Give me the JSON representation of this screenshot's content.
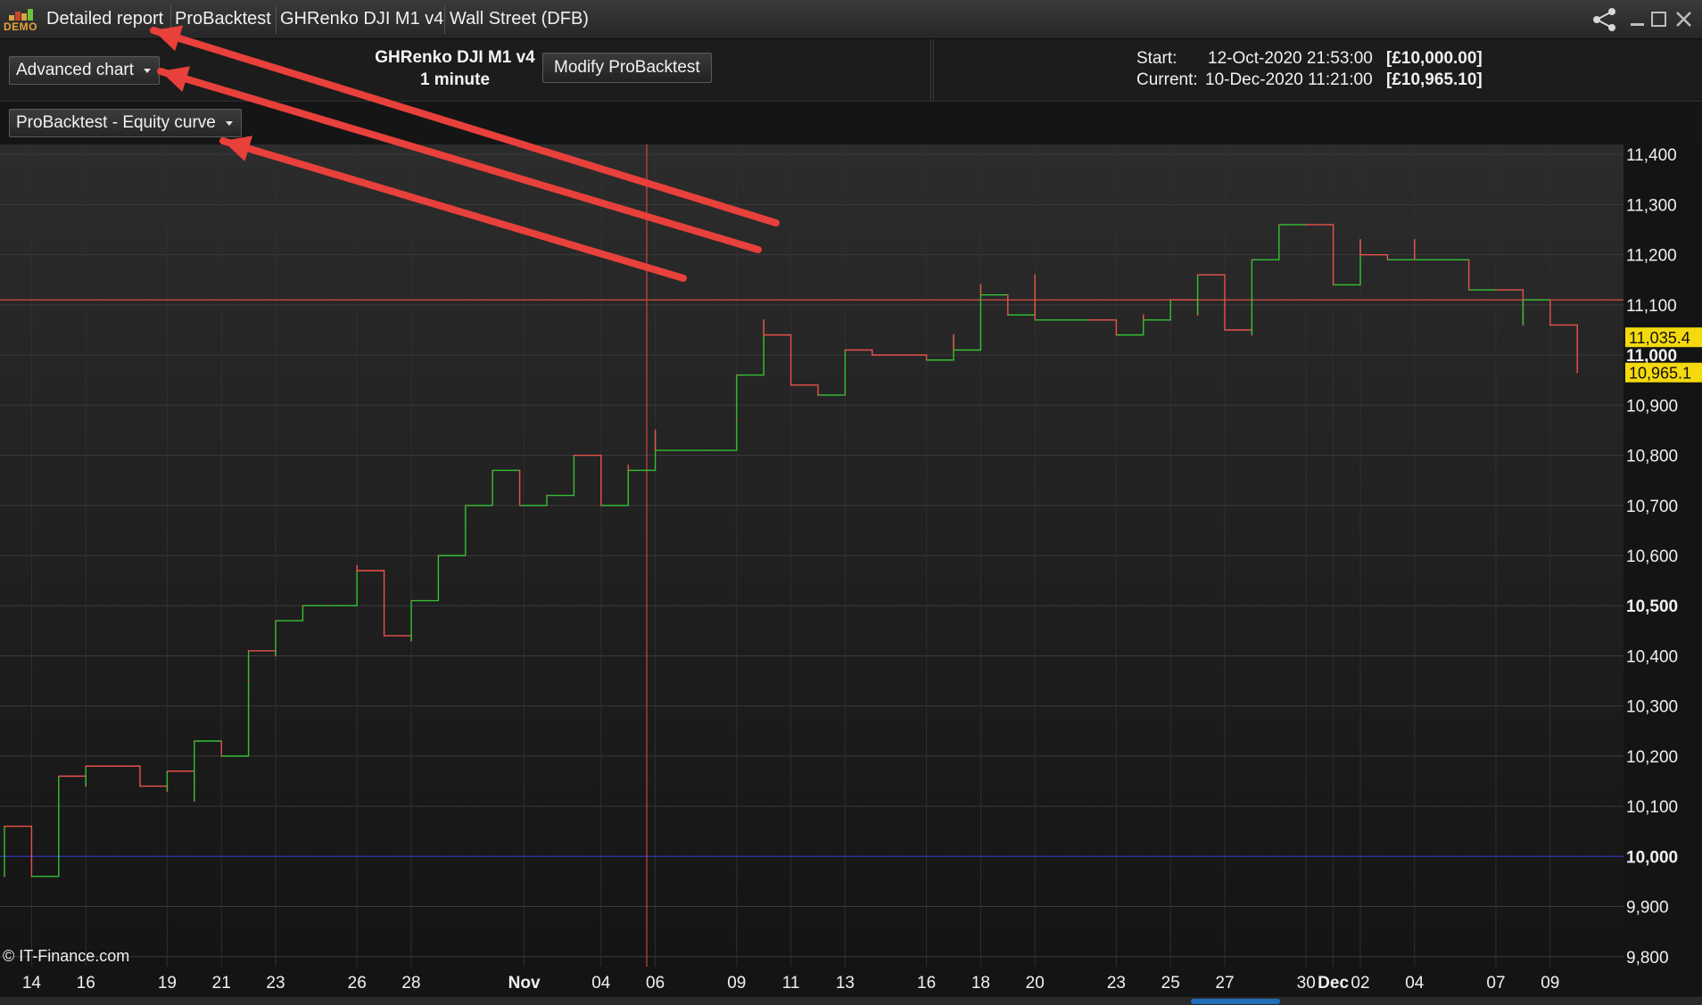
{
  "titlebar": {
    "logo_text": "DEMO",
    "tabs": [
      "Detailed report",
      "ProBacktest",
      "GHRenko DJI M1 v4",
      "Wall Street (DFB)"
    ],
    "icons": [
      "share-icon",
      "minimize-icon",
      "maximize-icon",
      "close-icon"
    ]
  },
  "header": {
    "chart_menu": "Advanced chart",
    "system_name": "GHRenko DJI M1 v4",
    "timeframe": "1 minute",
    "modify_button": "Modify ProBacktest",
    "start_label": "Start:",
    "start_date": "12-Oct-2020 21:53:00",
    "start_value": "[£10,000.00]",
    "current_label": "Current:",
    "current_date": "10-Dec-2020 11:21:00",
    "current_value": "[£10,965.10]"
  },
  "indicator_menu": "ProBacktest - Equity curve",
  "copyright": "© IT-Finance.com",
  "colors": {
    "up": "#33c233",
    "down": "#e8524a",
    "arrow": "#e8403a",
    "hline_red": "#c8473f",
    "hline_blue": "#2b33a8",
    "price_tag": "#f4d90e"
  },
  "chart_data": {
    "type": "line",
    "title": "ProBacktest - Equity curve",
    "ylim": [
      9780,
      11420
    ],
    "y_ticks": [
      9800,
      9900,
      10000,
      10100,
      10200,
      10300,
      10400,
      10500,
      10600,
      10700,
      10800,
      10900,
      11000,
      11100,
      11200,
      11300,
      11400
    ],
    "y_tick_labels": [
      "9,800",
      "9,900",
      "10,000",
      "10,100",
      "10,200",
      "10,300",
      "10,400",
      "10,500",
      "10,600",
      "10,700",
      "10,800",
      "10,900",
      "11,000",
      "11,100",
      "11,200",
      "11,300",
      "11,400"
    ],
    "bold_ticks": [
      "10,000",
      "10,500",
      "11,000"
    ],
    "x_tick_labels": [
      "14",
      "16",
      "19",
      "21",
      "23",
      "26",
      "28",
      "Nov",
      "04",
      "06",
      "09",
      "11",
      "13",
      "16",
      "18",
      "20",
      "23",
      "25",
      "27",
      "30",
      "Dec",
      "02",
      "04",
      "07",
      "09"
    ],
    "bold_x_ticks": [
      "Nov",
      "Dec"
    ],
    "reference_lines": [
      {
        "value": 10000,
        "color": "blue"
      },
      {
        "value": 11110,
        "color": "red"
      }
    ],
    "price_tags": [
      {
        "value": 11035.4,
        "label": "11,035.4"
      },
      {
        "value": 10965.1,
        "label": "10,965.1"
      }
    ],
    "equity": [
      {
        "x": "Oct 13",
        "y": 9960
      },
      {
        "x": "Oct 13",
        "y": 10060
      },
      {
        "x": "Oct 14",
        "y": 9990
      },
      {
        "x": "Oct 14",
        "y": 9960
      },
      {
        "x": "Oct 15",
        "y": 10140
      },
      {
        "x": "Oct 15",
        "y": 10160
      },
      {
        "x": "Oct 16",
        "y": 10140
      },
      {
        "x": "Oct 16",
        "y": 10180
      },
      {
        "x": "Oct 18",
        "y": 10140
      },
      {
        "x": "Oct 19",
        "y": 10130
      },
      {
        "x": "Oct 19",
        "y": 10170
      },
      {
        "x": "Oct 20",
        "y": 10110
      },
      {
        "x": "Oct 20",
        "y": 10230
      },
      {
        "x": "Oct 21",
        "y": 10230
      },
      {
        "x": "Oct 21",
        "y": 10200
      },
      {
        "x": "Oct 22",
        "y": 10350
      },
      {
        "x": "Oct 22",
        "y": 10410
      },
      {
        "x": "Oct 23",
        "y": 10400
      },
      {
        "x": "Oct 23",
        "y": 10470
      },
      {
        "x": "Oct 24",
        "y": 10500
      },
      {
        "x": "Oct 25",
        "y": 10500
      },
      {
        "x": "Oct 26",
        "y": 10580
      },
      {
        "x": "Oct 26",
        "y": 10570
      },
      {
        "x": "Oct 27",
        "y": 10560
      },
      {
        "x": "Oct 27",
        "y": 10440
      },
      {
        "x": "Oct 28",
        "y": 10430
      },
      {
        "x": "Oct 28",
        "y": 10510
      },
      {
        "x": "Oct 29",
        "y": 10600
      },
      {
        "x": "Oct 29",
        "y": 10600
      },
      {
        "x": "Oct 30",
        "y": 10600
      },
      {
        "x": "Oct 30",
        "y": 10700
      },
      {
        "x": "Oct 31",
        "y": 10770
      },
      {
        "x": "Nov 01",
        "y": 10770
      },
      {
        "x": "Nov 01",
        "y": 10700
      },
      {
        "x": "Nov 02",
        "y": 10720
      },
      {
        "x": "Nov 03",
        "y": 10740
      },
      {
        "x": "Nov 03",
        "y": 10800
      },
      {
        "x": "Nov 04",
        "y": 10700
      },
      {
        "x": "Nov 05",
        "y": 10780
      },
      {
        "x": "Nov 05",
        "y": 10770
      },
      {
        "x": "Nov 06",
        "y": 10850
      },
      {
        "x": "Nov 06",
        "y": 10810
      },
      {
        "x": "Nov 08",
        "y": 10810
      },
      {
        "x": "Nov 09",
        "y": 10870
      },
      {
        "x": "Nov 09",
        "y": 10960
      },
      {
        "x": "Nov 10",
        "y": 11070
      },
      {
        "x": "Nov 10",
        "y": 11040
      },
      {
        "x": "Nov 11",
        "y": 10940
      },
      {
        "x": "Nov 12",
        "y": 10920
      },
      {
        "x": "Nov 13",
        "y": 10920
      },
      {
        "x": "Nov 13",
        "y": 11010
      },
      {
        "x": "Nov 14",
        "y": 11000
      },
      {
        "x": "Nov 16",
        "y": 10990
      },
      {
        "x": "Nov 17",
        "y": 11040
      },
      {
        "x": "Nov 17",
        "y": 11010
      },
      {
        "x": "Nov 18",
        "y": 11140
      },
      {
        "x": "Nov 18",
        "y": 11120
      },
      {
        "x": "Nov 19",
        "y": 11120
      },
      {
        "x": "Nov 19",
        "y": 11080
      },
      {
        "x": "Nov 20",
        "y": 11160
      },
      {
        "x": "Nov 20",
        "y": 11070
      },
      {
        "x": "Nov 22",
        "y": 11070
      },
      {
        "x": "Nov 23",
        "y": 11040
      },
      {
        "x": "Nov 24",
        "y": 11080
      },
      {
        "x": "Nov 24",
        "y": 11070
      },
      {
        "x": "Nov 25",
        "y": 11110
      },
      {
        "x": "Nov 26",
        "y": 11080
      },
      {
        "x": "Nov 26",
        "y": 11160
      },
      {
        "x": "Nov 27",
        "y": 11050
      },
      {
        "x": "Nov 28",
        "y": 11040
      },
      {
        "x": "Nov 28",
        "y": 11190
      },
      {
        "x": "Nov 29",
        "y": 11260
      },
      {
        "x": "Nov 30",
        "y": 11260
      },
      {
        "x": "Dec 01",
        "y": 11210
      },
      {
        "x": "Dec 01",
        "y": 11140
      },
      {
        "x": "Dec 02",
        "y": 11230
      },
      {
        "x": "Dec 02",
        "y": 11200
      },
      {
        "x": "Dec 03",
        "y": 11190
      },
      {
        "x": "Dec 04",
        "y": 11230
      },
      {
        "x": "Dec 04",
        "y": 11190
      },
      {
        "x": "Dec 06",
        "y": 11190
      },
      {
        "x": "Dec 06",
        "y": 11130
      },
      {
        "x": "Dec 07",
        "y": 11130
      },
      {
        "x": "Dec 08",
        "y": 11060
      },
      {
        "x": "Dec 08",
        "y": 11110
      },
      {
        "x": "Dec 09",
        "y": 11110
      },
      {
        "x": "Dec 09",
        "y": 11060
      },
      {
        "x": "Dec 10",
        "y": 10990
      },
      {
        "x": "Dec 10",
        "y": 10965
      }
    ],
    "annotations": [
      "arrow to Detailed report",
      "arrow to Advanced chart",
      "arrow to ProBacktest - Equity curve"
    ]
  }
}
